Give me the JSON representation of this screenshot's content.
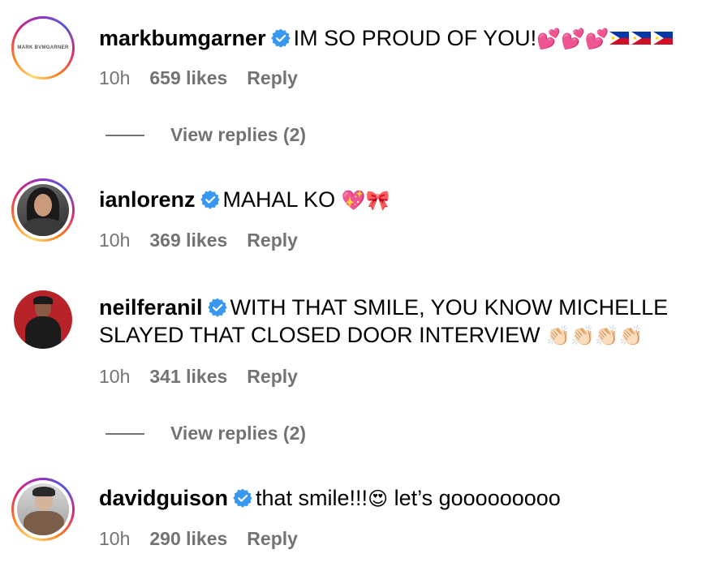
{
  "comments": [
    {
      "username": "markbumgarner",
      "text": "IM SO PROUD OF YOU!",
      "emojis": "💕💕💕",
      "time": "10h",
      "likes": "659 likes",
      "reply": "Reply",
      "view_replies": "View replies (2)",
      "avatar_logo_text": "MARK BVMGARNER"
    },
    {
      "username": "ianlorenz",
      "text": "MAHAL KO ",
      "emojis": "💖🎀",
      "time": "10h",
      "likes": "369 likes",
      "reply": "Reply"
    },
    {
      "username": "neilferanil",
      "text": "WITH THAT SMILE, YOU KNOW MICHELLE SLAYED THAT CLOSED DOOR INTERVIEW ",
      "emojis": "👏🏻👏🏻👏🏻👏🏻",
      "time": "10h",
      "likes": "341 likes",
      "reply": "Reply",
      "view_replies": "View replies (2)"
    },
    {
      "username": "davidguison",
      "text": "that smile!!!",
      "emoji_mid": "😍",
      "text_after": " let’s gooooooooo",
      "time": "10h",
      "likes": "290 likes",
      "reply": "Reply"
    }
  ],
  "colors": {
    "verified": "#3897f0",
    "meta": "#737373"
  }
}
